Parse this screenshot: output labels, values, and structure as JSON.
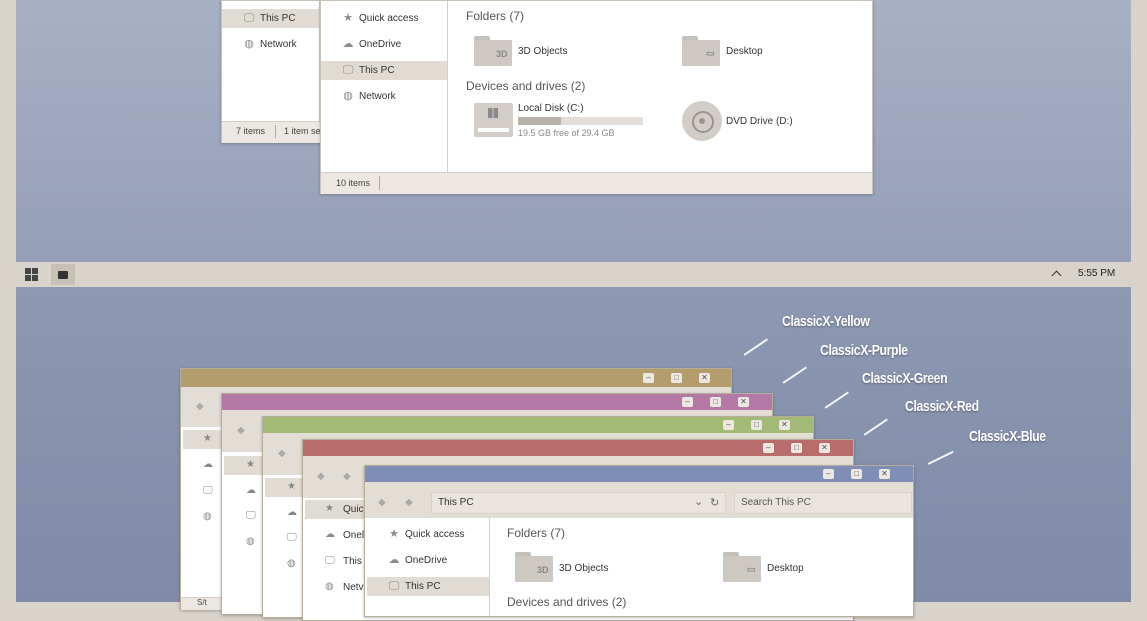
{
  "top_panel": {
    "back_window": {
      "nav": [
        {
          "icon": "monitor-icon",
          "label": "This PC",
          "selected": true
        },
        {
          "icon": "network-icon",
          "label": "Network",
          "selected": false
        }
      ],
      "status_items": "7 items",
      "status_selected": "1 item se"
    },
    "front_window": {
      "nav": [
        {
          "icon": "star-icon",
          "label": "Quick access",
          "selected": false
        },
        {
          "icon": "cloud-icon",
          "label": "OneDrive",
          "selected": false
        },
        {
          "icon": "monitor-icon",
          "label": "This PC",
          "selected": true
        },
        {
          "icon": "network-icon",
          "label": "Network",
          "selected": false
        }
      ],
      "folders_heading": "Folders (7)",
      "folders": [
        {
          "label": "3D Objects",
          "mark": "3D"
        },
        {
          "label": "Desktop",
          "mark": "▭"
        }
      ],
      "devices_heading": "Devices and drives (2)",
      "drive_c": {
        "label": "Local Disk (C:)",
        "free_text": "19.5 GB free of 29.4 GB",
        "used_fraction": 0.34
      },
      "drive_d": {
        "label": "DVD Drive (D:)"
      },
      "status_items": "10 items"
    }
  },
  "taskbar": {
    "clock": "5:55 PM",
    "chevron": "^"
  },
  "schemes": {
    "colors": {
      "yellow": "#b39d6c",
      "purple": "#b478a6",
      "green": "#a3ba77",
      "red": "#b86d6c",
      "blue": "#7e8eb5"
    },
    "labels": [
      "ClassicX-Yellow",
      "ClassicX-Purple",
      "ClassicX-Green",
      "ClassicX-Red",
      "ClassicX-Blue"
    ]
  },
  "front_blue_window": {
    "address": "This PC",
    "search_placeholder": "Search This PC",
    "nav": [
      {
        "icon": "star-icon",
        "label": "Quick access",
        "selected": false
      },
      {
        "icon": "cloud-icon",
        "label": "OneDrive",
        "selected": false
      },
      {
        "icon": "monitor-icon",
        "label": "This PC",
        "selected": true
      }
    ],
    "folders_heading": "Folders (7)",
    "folders": [
      {
        "label": "3D Objects",
        "mark": "3D"
      },
      {
        "label": "Desktop",
        "mark": "▭"
      }
    ],
    "devices_heading": "Devices and drives (2)"
  },
  "stack_partial_labels": {
    "quick": "Quic",
    "onedrive": "Onel",
    "thispc": "This",
    "network": "Netv",
    "status_yellow": "S/t"
  },
  "caption_buttons": {
    "minimize": "–",
    "maximize": "□",
    "close": "✕"
  },
  "glyphs": {
    "back": "◆",
    "forward": "◆",
    "chevron": "⌄",
    "refresh": "↻"
  }
}
